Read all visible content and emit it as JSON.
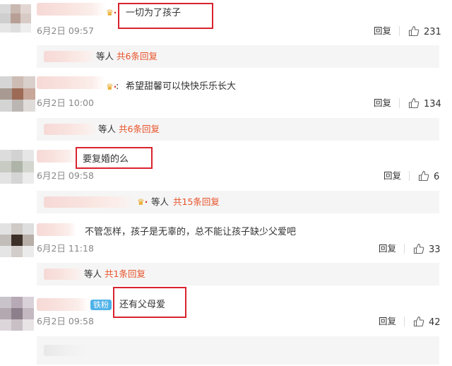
{
  "icons": {
    "like": "thumbs-up-icon",
    "vip": "crown-icon"
  },
  "colors": {
    "more_link": "#e8532a",
    "red_box": "#d9232e",
    "badge": "#4fb2e8"
  },
  "comments": [
    {
      "text": "一切为了孩子",
      "time": "6月2日 09:57",
      "reply_label": "回复",
      "likes": "231",
      "sub": {
        "etc": "等人",
        "more": "共6条回复"
      }
    },
    {
      "text": "希望甜馨可以快快乐乐长大",
      "time": "6月2日 10:00",
      "reply_label": "回复",
      "likes": "134",
      "sub": {
        "etc": "等人",
        "more": "共6条回复"
      }
    },
    {
      "text": "要复婚的么",
      "time": "6月2日 09:58",
      "reply_label": "回复",
      "likes": "6",
      "sub": {
        "etc": "等人",
        "more": "共15条回复"
      }
    },
    {
      "text": "不管怎样，孩子是无辜的，总不能让孩子缺少父爱吧",
      "time": "6月2日 11:18",
      "reply_label": "回复",
      "likes": "33",
      "sub": {
        "etc": "等人",
        "more": "共1条回复"
      }
    },
    {
      "text": "还有父母爱",
      "badge": "铁粉",
      "time": "6月2日 09:58",
      "reply_label": "回复",
      "likes": "42"
    }
  ]
}
